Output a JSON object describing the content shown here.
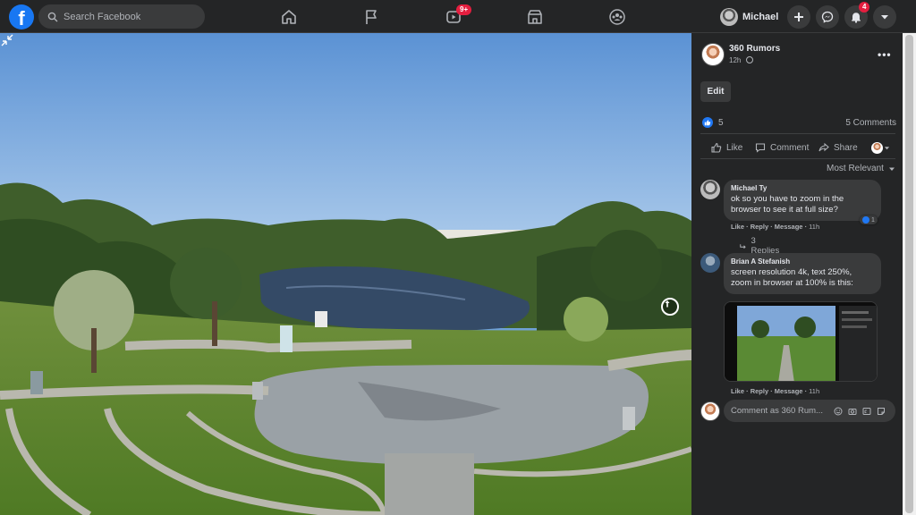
{
  "app": {
    "logo_letter": "f"
  },
  "search": {
    "placeholder": "Search Facebook"
  },
  "nav": {
    "watch_badge": "9+",
    "notifications_badge": "4"
  },
  "profile": {
    "name": "Michael"
  },
  "post": {
    "author": "360 Rumors",
    "time": "12h",
    "edit_label": "Edit",
    "likes": "5",
    "comments_count": "5 Comments",
    "actions": {
      "like": "Like",
      "comment": "Comment",
      "share": "Share"
    },
    "sort_label": "Most Relevant"
  },
  "comments": [
    {
      "name": "Michael Ty",
      "text": "ok so you have to zoom in the browser to see it at full size?",
      "reaction_count": "1",
      "like": "Like",
      "reply": "Reply",
      "message": "Message",
      "time": "11h",
      "replies": "3 Replies"
    },
    {
      "name": "Brian A Stefanish",
      "text": "screen resolution 4k, text 250%, zoom in browser at 100% is this:",
      "like": "Like",
      "reply": "Reply",
      "message": "Message",
      "time": "11h"
    }
  ],
  "compose": {
    "placeholder": "Comment as 360 Rum..."
  },
  "colors": {
    "brand": "#1877f2",
    "panel": "#242526",
    "badge": "#e41e3f"
  }
}
